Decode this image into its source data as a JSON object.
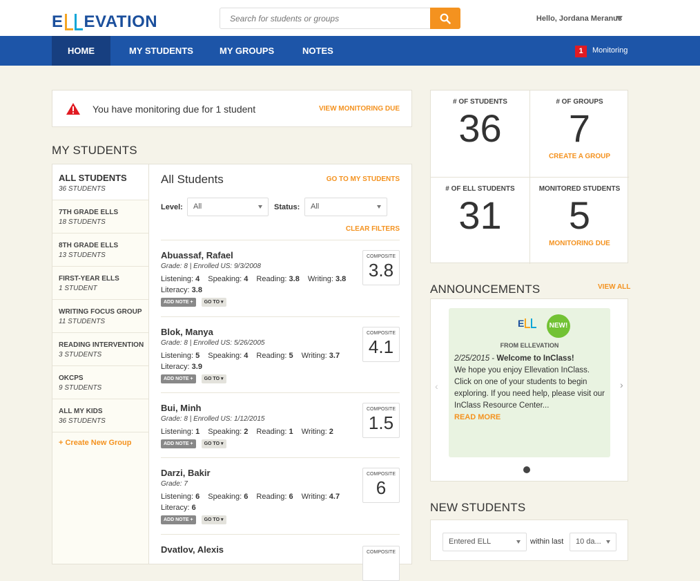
{
  "brand": {
    "name": "ELLEVATION",
    "tail": "EVATION"
  },
  "header": {
    "search_placeholder": "Search for students or groups",
    "user_greeting": "Hello, Jordana Meranus"
  },
  "nav": {
    "items": [
      "HOME",
      "MY STUDENTS",
      "MY GROUPS",
      "NOTES"
    ],
    "monitoring_count": "1",
    "monitoring_label": "Monitoring"
  },
  "alert": {
    "message": "You have monitoring due for 1 student",
    "action": "VIEW MONITORING DUE"
  },
  "my_students": {
    "section_title": "MY STUDENTS",
    "groups": [
      {
        "name": "ALL STUDENTS",
        "count": "36 STUDENTS"
      },
      {
        "name": "7TH GRADE ELLS",
        "count": "18 STUDENTS"
      },
      {
        "name": "8TH GRADE ELLS",
        "count": "13 STUDENTS"
      },
      {
        "name": "FIRST-YEAR ELLS",
        "count": "1 STUDENT"
      },
      {
        "name": "WRITING FOCUS GROUP",
        "count": "11 STUDENTS"
      },
      {
        "name": "READING INTERVENTION",
        "count": "3 STUDENTS"
      },
      {
        "name": "OKCPS",
        "count": "9 STUDENTS"
      },
      {
        "name": "ALL MY KIDS",
        "count": "36 STUDENTS"
      }
    ],
    "create_group": "+ Create New Group",
    "list_title": "All Students",
    "go_to_link": "GO TO MY STUDENTS",
    "filters": {
      "level_label": "Level:",
      "level_value": "All",
      "status_label": "Status:",
      "status_value": "All",
      "clear": "CLEAR FILTERS"
    },
    "labels": {
      "listening": "Listening:",
      "speaking": "Speaking:",
      "reading": "Reading:",
      "writing": "Writing:",
      "literacy": "Literacy:",
      "composite": "COMPOSITE",
      "add_note": "ADD NOTE +",
      "go_to": "GO TO"
    },
    "students": [
      {
        "name": "Abuassaf, Rafael",
        "meta": "Grade: 8 | Enrolled US: 9/3/2008",
        "listening": "4",
        "speaking": "4",
        "reading": "3.8",
        "writing": "3.8",
        "literacy": "3.8",
        "composite": "3.8"
      },
      {
        "name": "Blok, Manya",
        "meta": "Grade: 8 | Enrolled US: 5/26/2005",
        "listening": "5",
        "speaking": "4",
        "reading": "5",
        "writing": "3.7",
        "literacy": "3.9",
        "composite": "4.1"
      },
      {
        "name": "Bui, Minh",
        "meta": "Grade: 8 | Enrolled US: 1/12/2015",
        "listening": "1",
        "speaking": "2",
        "reading": "1",
        "writing": "2",
        "composite": "1.5"
      },
      {
        "name": "Darzi, Bakir",
        "meta": "Grade: 7",
        "listening": "6",
        "speaking": "6",
        "reading": "6",
        "writing": "4.7",
        "literacy": "6",
        "composite": "6"
      },
      {
        "name": "Dvatlov, Alexis",
        "composite_label": "COMPOSITE"
      }
    ]
  },
  "stats": {
    "students_label": "# OF STUDENTS",
    "students": "36",
    "groups_label": "# OF GROUPS",
    "groups": "7",
    "groups_action": "CREATE A GROUP",
    "ell_label": "# OF ELL STUDENTS",
    "ell": "31",
    "monitored_label": "MONITORED STUDENTS",
    "monitored": "5",
    "monitored_action": "MONITORING DUE"
  },
  "announcements": {
    "title": "ANNOUNCEMENTS",
    "view_all": "VIEW ALL",
    "badge": "NEW!",
    "from": "FROM ELLEVATION",
    "date": "2/25/2015",
    "headline": "Welcome to InClass!",
    "body": "We hope you enjoy Ellevation InClass. Click on one of your students to begin exploring. If you need help, please visit our InClass Resource Center...",
    "read_more": "READ MORE"
  },
  "new_students": {
    "title": "NEW STUDENTS",
    "filter_value": "Entered ELL",
    "within_label": "within last",
    "range_value": "10 da..."
  },
  "colors": {
    "nav": "#1d55a8",
    "nav_active": "#173f80",
    "accent": "#f4921f",
    "alert_red": "#e11b22",
    "background": "#f5f3e9"
  }
}
